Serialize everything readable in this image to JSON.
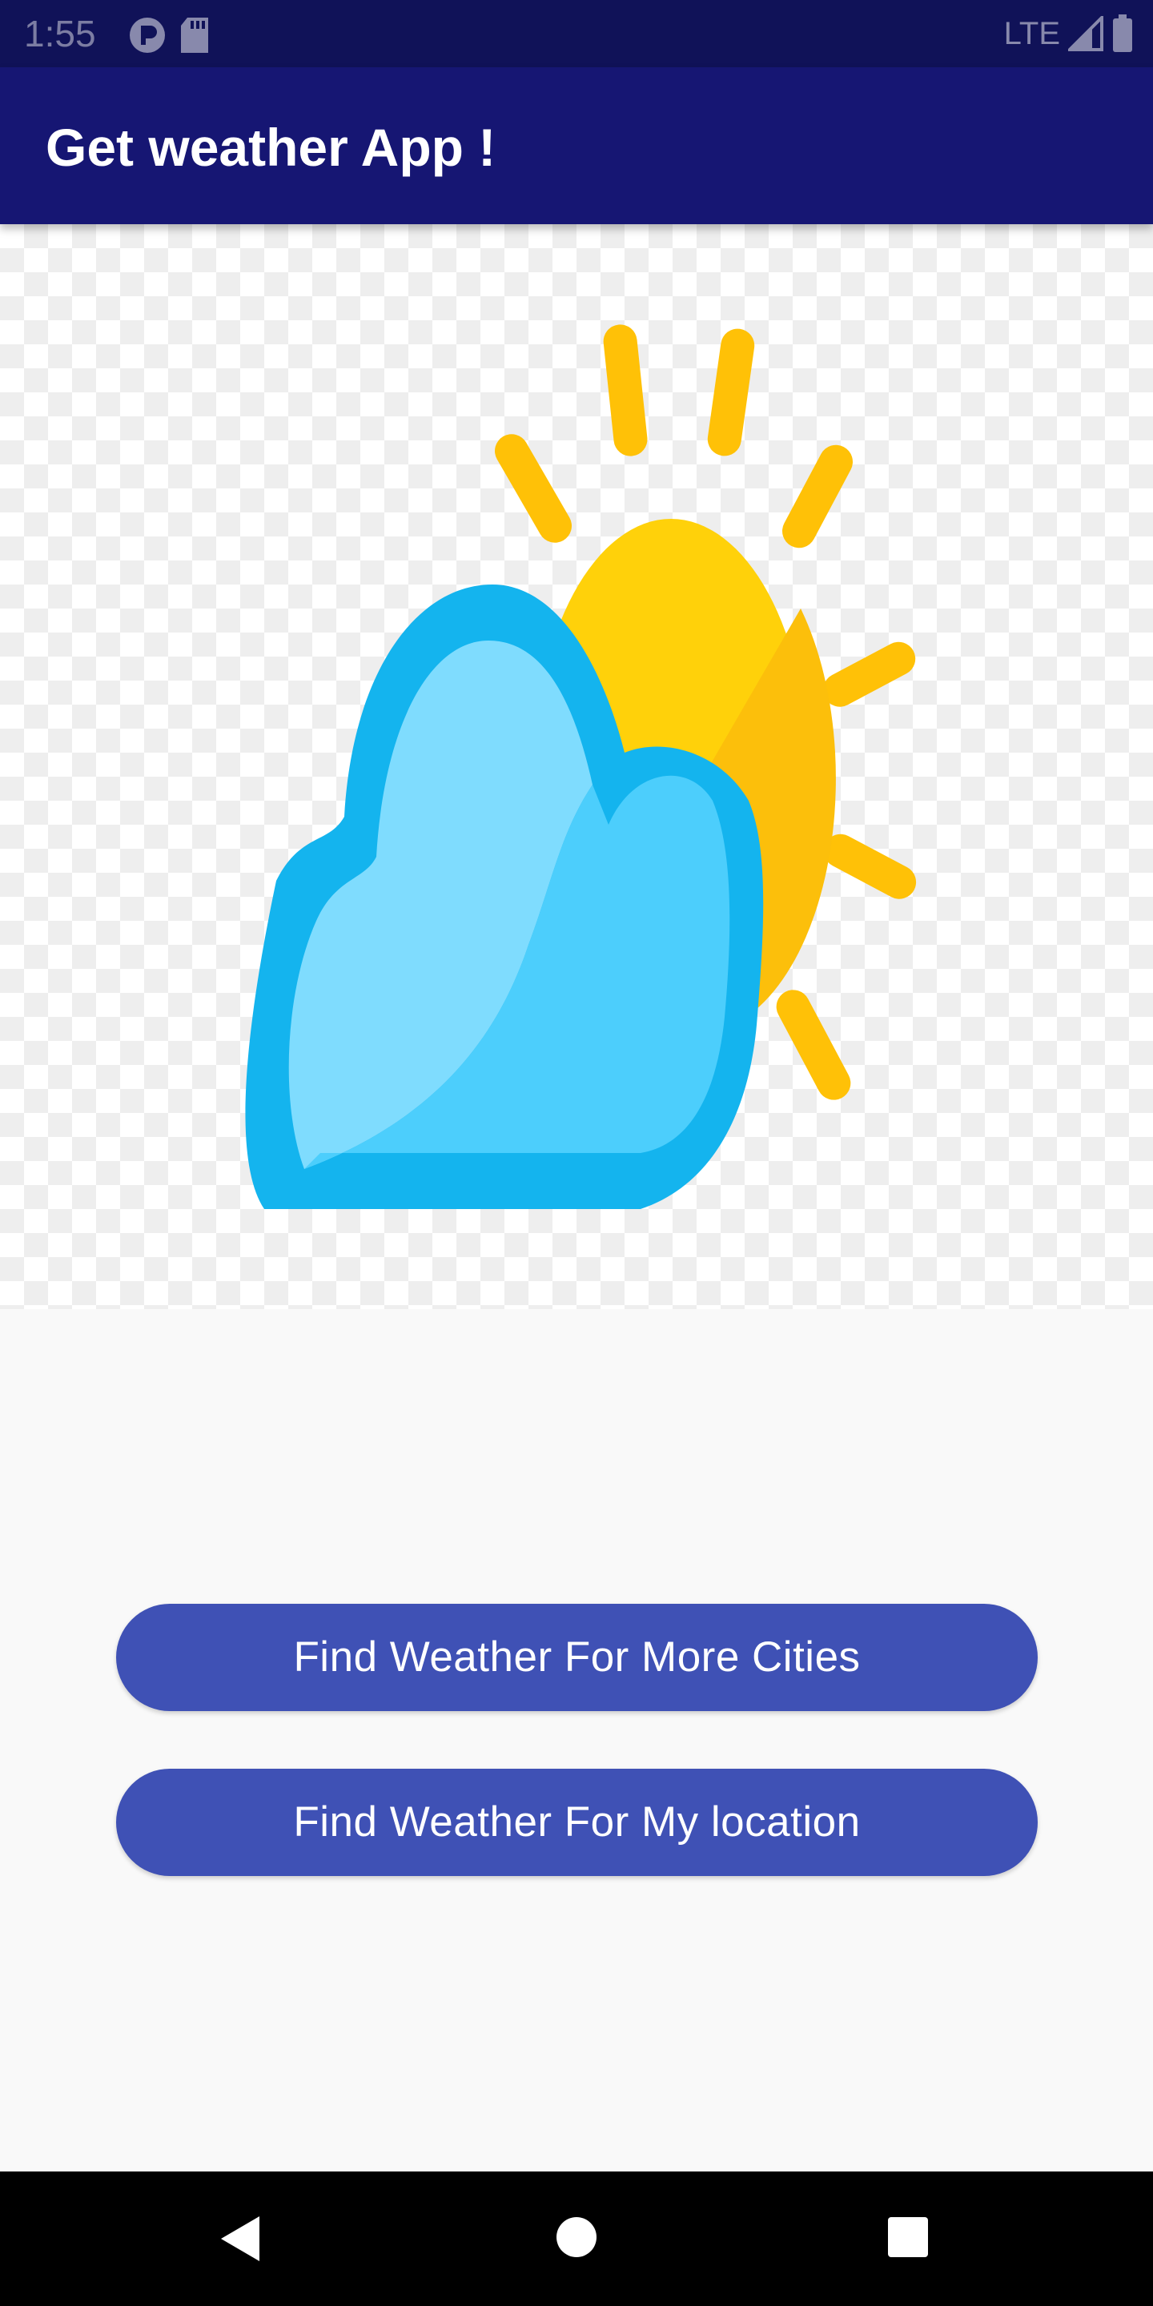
{
  "status_bar": {
    "time": "1:55",
    "network": "LTE",
    "icons": [
      "notification-icon",
      "sd-card-icon",
      "signal-icon",
      "battery-icon"
    ]
  },
  "app_bar": {
    "title": "Get weather App !"
  },
  "hero": {
    "image": "partly-cloudy-weather-icon"
  },
  "buttons": {
    "more_cities": "Find Weather For More Cities",
    "my_location": "Find Weather For My location"
  },
  "nav_bar": {
    "icons": [
      "back-icon",
      "home-icon",
      "recents-icon"
    ]
  },
  "colors": {
    "status_bar": "#101258",
    "app_bar": "#161673",
    "button": "#3f51b5",
    "background": "#f9f9f9",
    "sun": "#ffc107",
    "cloud": "#14b4ee"
  }
}
